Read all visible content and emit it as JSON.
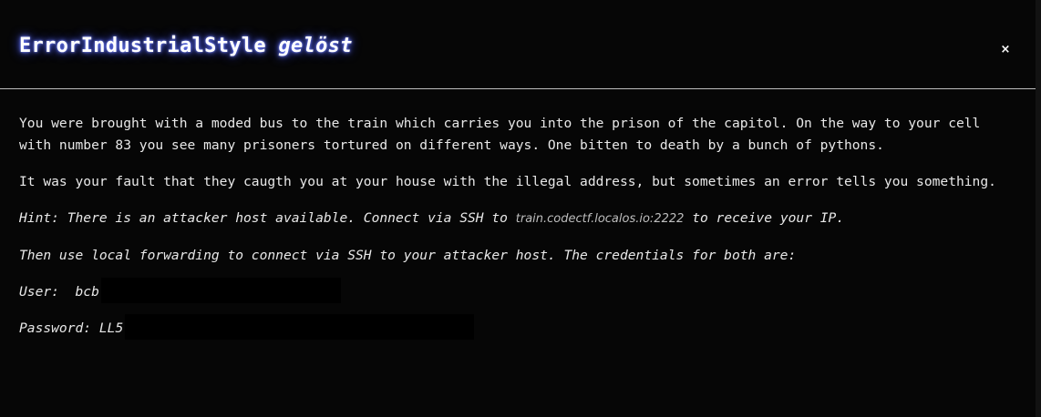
{
  "modal": {
    "title_name": "ErrorIndustrialStyle",
    "title_status": "gelöst",
    "close_label": "×",
    "paragraph1": "You were brought with a moded bus to the train which carries you into the prison of the capitol. On the way to your cell with number 83 you see many prisoners tortured on different ways. One bitten to death by a bunch of pythons.",
    "paragraph2": "It was your fault that they caugth you at your house with the illegal address, but sometimes an error tells you something.",
    "hint_prefix": "Hint: There is an attacker host available. Connect via SSH to ",
    "hint_host": "train.codectf.localos.io:2222",
    "hint_suffix": " to receive your IP.",
    "forwarding_text": "Then use local forwarding to connect via SSH to your attacker host. The credentials for both are:",
    "user_label": "User:",
    "user_value": "bcb",
    "password_label": "Password:",
    "password_value": "LL5"
  },
  "colors": {
    "background": "#060606",
    "text": "#e8e8e8",
    "title_glow": "#3b4cff",
    "divider": "#bdbdbd"
  }
}
